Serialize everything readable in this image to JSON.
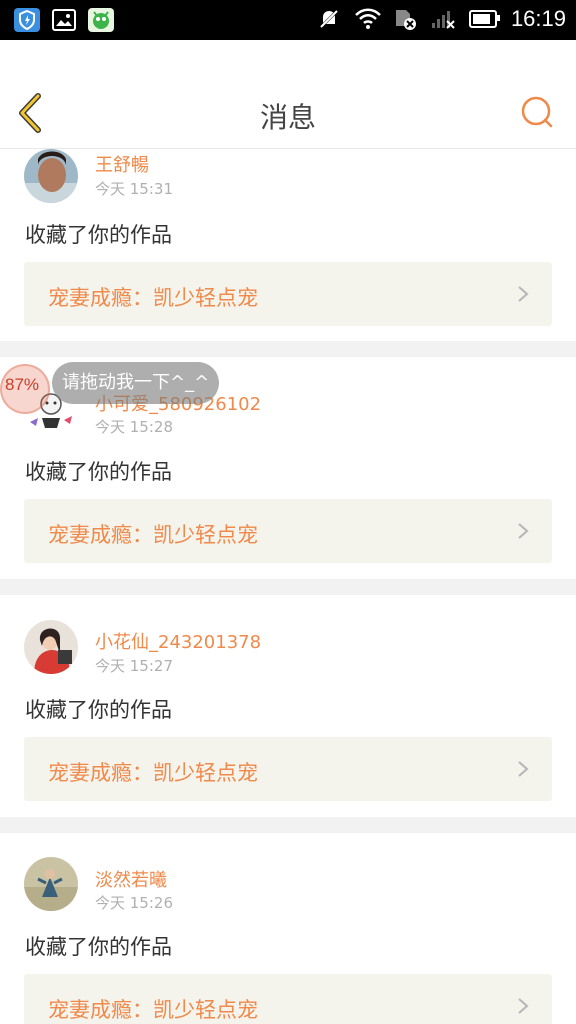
{
  "status_bar": {
    "time": "16:19",
    "icons": [
      "shield-app-icon",
      "gallery-icon",
      "game-app-icon",
      "silent-icon",
      "wifi-icon",
      "sim-off-icon",
      "signal-icon",
      "battery-icon"
    ],
    "battery_level": 0.85
  },
  "header": {
    "title": "消息",
    "accent_color": "#f0894a",
    "back_icon": "chevron-left-icon",
    "search_icon": "search-icon"
  },
  "messages": [
    {
      "username": "王舒暢",
      "time": "今天 15:31",
      "action": "收藏了你的作品",
      "work_title": "宠妻成瘾：凯少轻点宠"
    },
    {
      "username": "小可爱_580926102",
      "time": "今天 15:28",
      "action": "收藏了你的作品",
      "work_title": "宠妻成瘾：凯少轻点宠"
    },
    {
      "username": "小花仙_243201378",
      "time": "今天 15:27",
      "action": "收藏了你的作品",
      "work_title": "宠妻成瘾：凯少轻点宠"
    },
    {
      "username": "淡然若曦",
      "time": "今天 15:26",
      "action": "收藏了你的作品",
      "work_title": "宠妻成瘾：凯少轻点宠"
    }
  ],
  "overlay": {
    "percent": "87%",
    "tip": "请拖动我一下^_^"
  }
}
